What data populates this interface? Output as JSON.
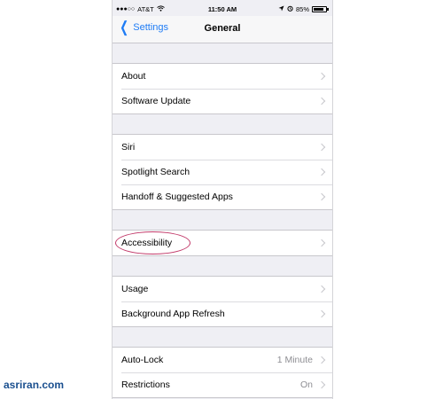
{
  "status_bar": {
    "signal": "●●●○○",
    "carrier": "AT&T",
    "wifi_icon": "wifi-icon",
    "time": "11:50 AM",
    "battery_percent": "85%",
    "battery_level": 0.85
  },
  "nav": {
    "back_label": "Settings",
    "title": "General"
  },
  "groups": [
    {
      "rows": [
        {
          "label": "About"
        },
        {
          "label": "Software Update"
        }
      ]
    },
    {
      "rows": [
        {
          "label": "Siri"
        },
        {
          "label": "Spotlight Search"
        },
        {
          "label": "Handoff & Suggested Apps"
        }
      ]
    },
    {
      "rows": [
        {
          "label": "Accessibility",
          "highlighted": true
        }
      ]
    },
    {
      "rows": [
        {
          "label": "Usage"
        },
        {
          "label": "Background App Refresh"
        }
      ]
    },
    {
      "rows": [
        {
          "label": "Auto-Lock",
          "value": "1 Minute"
        },
        {
          "label": "Restrictions",
          "value": "On"
        }
      ]
    }
  ],
  "watermark": "asriran.com",
  "colors": {
    "accent": "#1f7cf5",
    "highlight": "#c23a6a",
    "watermark": "#1a4f8f"
  }
}
